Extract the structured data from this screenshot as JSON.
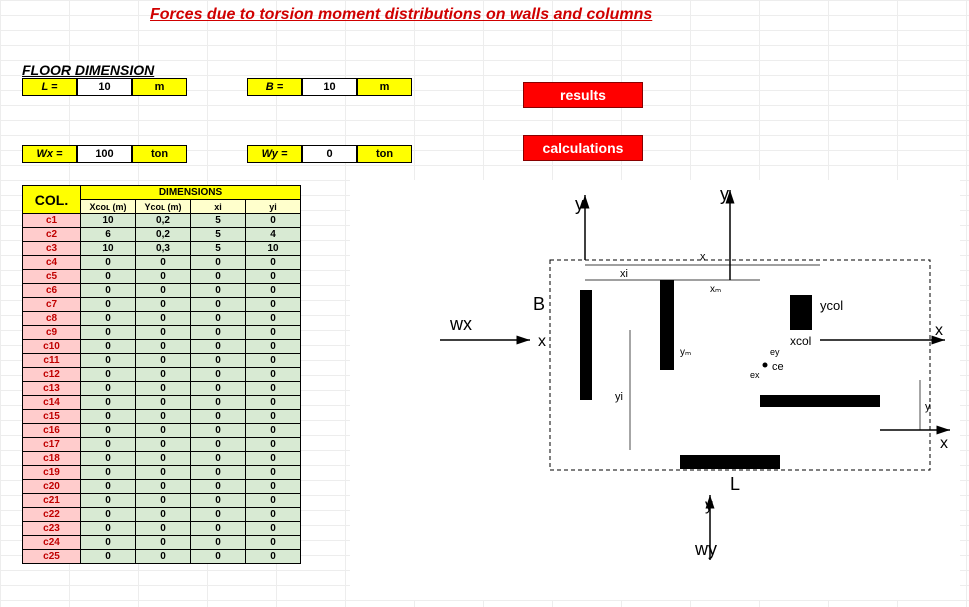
{
  "title": "Forces due to torsion moment distributions on walls and columns",
  "floor_dim_label": "FLOOR DIMENSION",
  "L": {
    "label": "L =",
    "value": "10",
    "unit": "m"
  },
  "B": {
    "label": "B  =",
    "value": "10",
    "unit": "m"
  },
  "Wx": {
    "label": "Wx =",
    "value": "100",
    "unit": "ton"
  },
  "Wy": {
    "label": "Wy =",
    "value": "0",
    "unit": "ton"
  },
  "buttons": {
    "results": "results",
    "calculations": "calculations"
  },
  "table": {
    "col_header": "COL.",
    "dim_header": "DIMENSIONS",
    "subheaders": [
      "Xᴄᴏʟ (m)",
      "Yᴄᴏʟ (m)",
      "xi",
      "yi"
    ],
    "rows": [
      {
        "id": "c1",
        "v": [
          "10",
          "0,2",
          "5",
          "0"
        ]
      },
      {
        "id": "c2",
        "v": [
          "6",
          "0,2",
          "5",
          "4"
        ]
      },
      {
        "id": "c3",
        "v": [
          "10",
          "0,3",
          "5",
          "10"
        ]
      },
      {
        "id": "c4",
        "v": [
          "0",
          "0",
          "0",
          "0"
        ]
      },
      {
        "id": "c5",
        "v": [
          "0",
          "0",
          "0",
          "0"
        ]
      },
      {
        "id": "c6",
        "v": [
          "0",
          "0",
          "0",
          "0"
        ]
      },
      {
        "id": "c7",
        "v": [
          "0",
          "0",
          "0",
          "0"
        ]
      },
      {
        "id": "c8",
        "v": [
          "0",
          "0",
          "0",
          "0"
        ]
      },
      {
        "id": "c9",
        "v": [
          "0",
          "0",
          "0",
          "0"
        ]
      },
      {
        "id": "c10",
        "v": [
          "0",
          "0",
          "0",
          "0"
        ]
      },
      {
        "id": "c11",
        "v": [
          "0",
          "0",
          "0",
          "0"
        ]
      },
      {
        "id": "c12",
        "v": [
          "0",
          "0",
          "0",
          "0"
        ]
      },
      {
        "id": "c13",
        "v": [
          "0",
          "0",
          "0",
          "0"
        ]
      },
      {
        "id": "c14",
        "v": [
          "0",
          "0",
          "0",
          "0"
        ]
      },
      {
        "id": "c15",
        "v": [
          "0",
          "0",
          "0",
          "0"
        ]
      },
      {
        "id": "c16",
        "v": [
          "0",
          "0",
          "0",
          "0"
        ]
      },
      {
        "id": "c17",
        "v": [
          "0",
          "0",
          "0",
          "0"
        ]
      },
      {
        "id": "c18",
        "v": [
          "0",
          "0",
          "0",
          "0"
        ]
      },
      {
        "id": "c19",
        "v": [
          "0",
          "0",
          "0",
          "0"
        ]
      },
      {
        "id": "c20",
        "v": [
          "0",
          "0",
          "0",
          "0"
        ]
      },
      {
        "id": "c21",
        "v": [
          "0",
          "0",
          "0",
          "0"
        ]
      },
      {
        "id": "c22",
        "v": [
          "0",
          "0",
          "0",
          "0"
        ]
      },
      {
        "id": "c23",
        "v": [
          "0",
          "0",
          "0",
          "0"
        ]
      },
      {
        "id": "c24",
        "v": [
          "0",
          "0",
          "0",
          "0"
        ]
      },
      {
        "id": "c25",
        "v": [
          "0",
          "0",
          "0",
          "0"
        ]
      }
    ]
  },
  "diagram": {
    "wx": "wx",
    "wy": "wy",
    "y_top": "y",
    "y_top2": "y",
    "x_left": "x",
    "x_right": "x",
    "x_right2": "x",
    "B": "B",
    "L": "L",
    "xcol": "xcol",
    "ycol": "ycol",
    "xi": "xi",
    "yi": "yi",
    "x_lbl": "x",
    "y_lbl": "y",
    "xm": "xₘ",
    "ym": "yₘ",
    "ce": "ce",
    "ey": "ey",
    "ex": "ex"
  }
}
